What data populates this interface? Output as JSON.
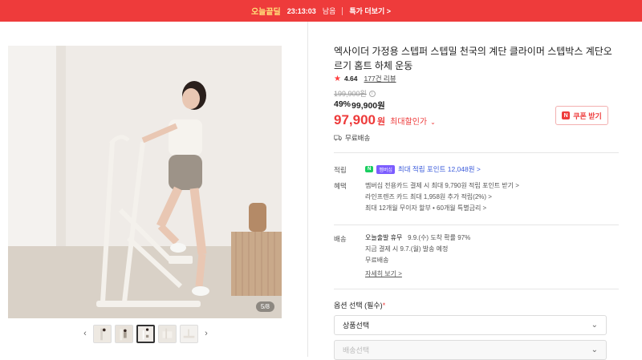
{
  "banner": {
    "brand": "오늘끝딜",
    "timer": "23:13:03",
    "timer_suffix": "남음",
    "more": "특가 더보기 >"
  },
  "gallery": {
    "counter": "5/8",
    "prev": "‹",
    "next": "›",
    "thumb_count": 5,
    "active_index": 2
  },
  "product": {
    "title": "엑사이더 가정용 스텝퍼 스텝밀 천국의 계단 클라이머 스텝박스 계단오르기 홈트 하체 운동",
    "rating": "4.64",
    "reviews": "177건 리뷰",
    "original_price": "199,900원",
    "discount_pct": "49%",
    "sale_price": "99,900원",
    "final_price": "97,900",
    "final_unit": "원",
    "max_discount_label": "최대할인가",
    "coupon_label": "쿠폰 받기",
    "shipping": "무료배송"
  },
  "points": {
    "label": "적립",
    "npay": "N",
    "member": "멤버십",
    "text": "최대 적립 포인트 12,048원 >"
  },
  "benefits": {
    "label": "혜택",
    "items": [
      "멤버십 전용카드 결제 시 최대 9,790원 적립 포인트 받기 >",
      "라인프렌즈 카드 최대 1,958원 추가 적립(2%) >",
      "최대 12개월 무이자 할부 • 60개월 특별금리 >"
    ]
  },
  "delivery": {
    "label": "배송",
    "line1_a": "오늘출발 휴무",
    "line1_b": "9.9.(수) 도착 확률 97%",
    "line2": "지금 결제 시 9.7.(월) 발송 예정",
    "line3": "무료배송",
    "detail": "자세히 보기 >"
  },
  "options": {
    "label": "옵션 선택 (필수)",
    "required_mark": "*",
    "product_select": "상품선택",
    "delivery_select": "배송선택"
  },
  "colors": {
    "accent": "#ee3b3b",
    "points_blue": "#3b5bdb",
    "npay_green": "#19ce60"
  }
}
